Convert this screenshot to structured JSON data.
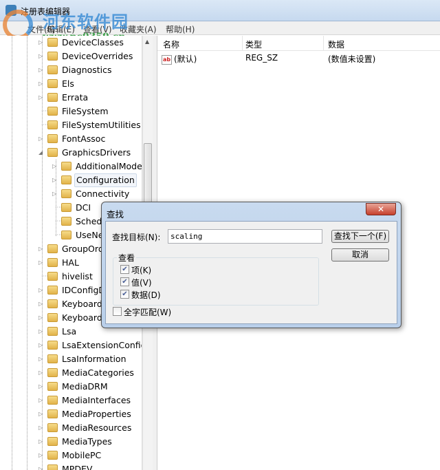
{
  "window": {
    "title": "注册表编辑器"
  },
  "watermark": {
    "name": "河东软件园",
    "url": "www.pc0359.cn"
  },
  "menu": [
    "文件(F)",
    "编辑(E)",
    "查看(V)",
    "收藏夹(A)",
    "帮助(H)"
  ],
  "tree": [
    {
      "label": "DeviceClasses",
      "level": 0,
      "exp": "closed"
    },
    {
      "label": "DeviceOverrides",
      "level": 0,
      "exp": "closed"
    },
    {
      "label": "Diagnostics",
      "level": 0,
      "exp": "closed"
    },
    {
      "label": "Els",
      "level": 0,
      "exp": "closed"
    },
    {
      "label": "Errata",
      "level": 0,
      "exp": "closed"
    },
    {
      "label": "FileSystem",
      "level": 0,
      "exp": "none"
    },
    {
      "label": "FileSystemUtilities",
      "level": 0,
      "exp": "none"
    },
    {
      "label": "FontAssoc",
      "level": 0,
      "exp": "closed"
    },
    {
      "label": "GraphicsDrivers",
      "level": 0,
      "exp": "open"
    },
    {
      "label": "AdditionalModeLists",
      "level": 1,
      "exp": "closed"
    },
    {
      "label": "Configuration",
      "level": 1,
      "exp": "closed",
      "selected": true
    },
    {
      "label": "Connectivity",
      "level": 1,
      "exp": "closed"
    },
    {
      "label": "DCI",
      "level": 1,
      "exp": "none"
    },
    {
      "label": "Scheduler",
      "level": 1,
      "exp": "none"
    },
    {
      "label": "UseNewKey",
      "level": 1,
      "exp": "none"
    },
    {
      "label": "GroupOrderList",
      "level": 0,
      "exp": "closed"
    },
    {
      "label": "HAL",
      "level": 0,
      "exp": "closed"
    },
    {
      "label": "hivelist",
      "level": 0,
      "exp": "none"
    },
    {
      "label": "IDConfigDB",
      "level": 0,
      "exp": "closed"
    },
    {
      "label": "Keyboard Layout",
      "level": 0,
      "exp": "closed"
    },
    {
      "label": "Keyboard Layouts",
      "level": 0,
      "exp": "closed"
    },
    {
      "label": "Lsa",
      "level": 0,
      "exp": "closed"
    },
    {
      "label": "LsaExtensionConfig",
      "level": 0,
      "exp": "closed"
    },
    {
      "label": "LsaInformation",
      "level": 0,
      "exp": "closed"
    },
    {
      "label": "MediaCategories",
      "level": 0,
      "exp": "closed"
    },
    {
      "label": "MediaDRM",
      "level": 0,
      "exp": "closed"
    },
    {
      "label": "MediaInterfaces",
      "level": 0,
      "exp": "closed"
    },
    {
      "label": "MediaProperties",
      "level": 0,
      "exp": "closed"
    },
    {
      "label": "MediaResources",
      "level": 0,
      "exp": "closed"
    },
    {
      "label": "MediaTypes",
      "level": 0,
      "exp": "closed"
    },
    {
      "label": "MobilePC",
      "level": 0,
      "exp": "closed"
    },
    {
      "label": "MPDEV",
      "level": 0,
      "exp": "closed"
    }
  ],
  "list": {
    "columns": [
      "名称",
      "类型",
      "数据"
    ],
    "rows": [
      {
        "name": "(默认)",
        "type": "REG_SZ",
        "data": "(数值未设置)"
      }
    ],
    "value_icon_text": "ab"
  },
  "dialog": {
    "title": "查找",
    "close": "✕",
    "find_label": "查找目标(N):",
    "find_value": "scaling",
    "find_next": "查找下一个(F)",
    "cancel": "取消",
    "group": "查看",
    "keys": "项(K)",
    "values": "值(V)",
    "data": "数据(D)",
    "whole": "全字匹配(W)",
    "keys_checked": true,
    "values_checked": true,
    "data_checked": true,
    "whole_checked": false
  }
}
